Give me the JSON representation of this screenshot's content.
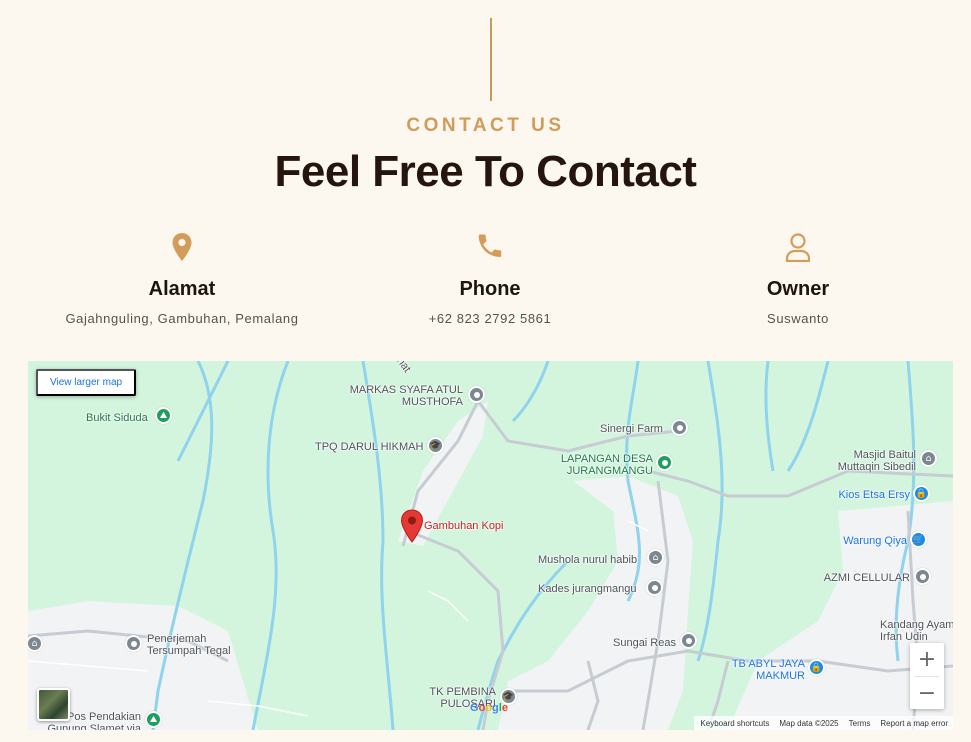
{
  "header": {
    "eyebrow": "CONTACT US",
    "title": "Feel Free To Contact"
  },
  "info": [
    {
      "icon": "location-pin-icon",
      "label": "Alamat",
      "value": "Gajahnguling, Gambuhan, Pemalang"
    },
    {
      "icon": "phone-icon",
      "label": "Phone",
      "value": "+62 823 2792 5861"
    },
    {
      "icon": "user-icon",
      "label": "Owner",
      "value": "Suswanto"
    }
  ],
  "colors": {
    "accent": "#cf9c5c",
    "background": "#fdf8ef",
    "title": "#24150f"
  },
  "map": {
    "view_larger": "View larger map",
    "marker_label": "Gambuhan Kopi",
    "places": {
      "markas": "MARKAS SYAFA ATUL\nMUSTHOFA",
      "bukit": "Bukit Siduda",
      "tpq": "TPQ DARUL HIKMAH",
      "sinergi": "Sinergi Farm",
      "lapangan": "LAPANGAN DESA\nJURANGMANGU",
      "masjid": "Masjid Baitul\nMuttaqin Sibedil",
      "kios": "Kios Etsa Ersy",
      "warung": "Warung Qiya",
      "mushola": "Mushola nurul habib",
      "kades": "Kades jurangmangu",
      "azmi": "AZMI CELLULAR",
      "penerjemah": "Penerjemah\nTersumpah Tegal",
      "kandang": "Kandang Ayam\nIrfan Udin",
      "sungai": "Sungai Reas",
      "tbabyl": "TB ABYL JAYA\nMAKMUR",
      "tkpembina": "TK PEMBINA\nPULOSARI",
      "pos": "Pos Pendakian\nGunung Slamet via",
      "road": "nat"
    },
    "zoom_in": "+",
    "zoom_out": "−",
    "google": "Google",
    "attribution": {
      "shortcuts": "Keyboard shortcuts",
      "data": "Map data ©2025",
      "terms": "Terms",
      "report": "Report a map error"
    }
  }
}
